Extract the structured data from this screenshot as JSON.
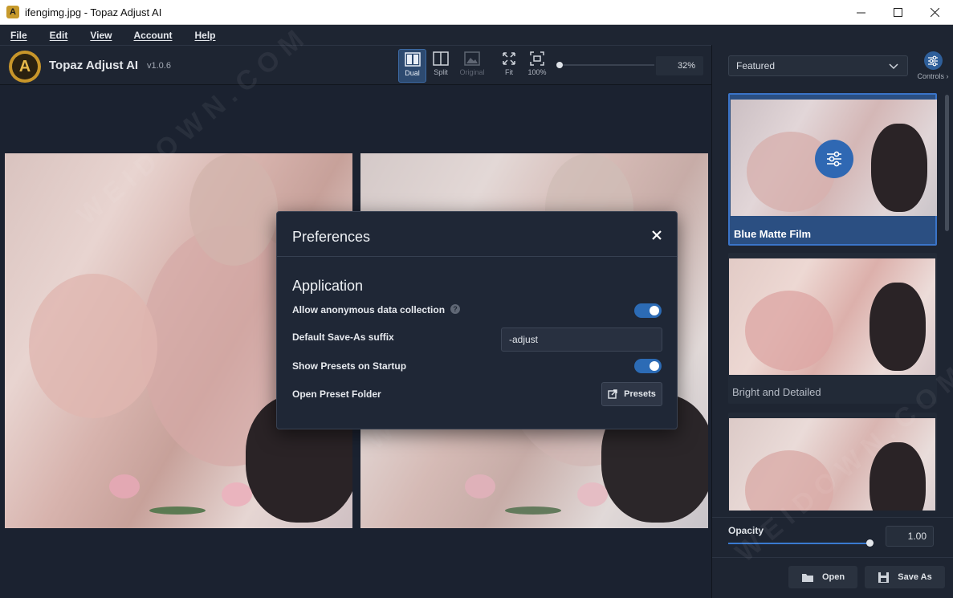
{
  "window": {
    "title": "ifengimg.jpg - Topaz Adjust AI",
    "app_glyph": "A",
    "minimize_icon": "minimize-icon",
    "maximize_icon": "maximize-icon",
    "close_icon": "close-icon"
  },
  "menu": [
    "File",
    "Edit",
    "View",
    "Account",
    "Help"
  ],
  "app": {
    "name": "Topaz Adjust AI",
    "version": "v1.0.6",
    "logo_letter": "A",
    "accent": "#c8962a"
  },
  "toolbar": {
    "view_modes": [
      {
        "label": "Dual",
        "icon": "dual-view-icon",
        "active": true
      },
      {
        "label": "Split",
        "icon": "split-view-icon",
        "active": false
      },
      {
        "label": "Original",
        "icon": "original-view-icon",
        "active": false,
        "disabled": true
      }
    ],
    "fit_label": "Fit",
    "actual_size_label": "100%",
    "zoom_value": "32%",
    "zoom_fraction": 0.0
  },
  "sidebar": {
    "filter_selected": "Featured",
    "controls_label": "Controls",
    "presets": [
      {
        "name": "Blue Matte Film",
        "selected": true
      },
      {
        "name": "Bright and Detailed",
        "selected": false
      },
      {
        "name": "",
        "selected": false
      }
    ],
    "opacity_label": "Opacity",
    "opacity_value": "1.00",
    "opacity_fraction": 1.0,
    "open_label": "Open",
    "save_as_label": "Save As"
  },
  "dialog": {
    "title": "Preferences",
    "section": "Application",
    "rows": {
      "anon_label": "Allow anonymous data collection",
      "anon_on": true,
      "suffix_label": "Default Save-As suffix",
      "suffix_value": "-adjust",
      "startup_label": "Show Presets on Startup",
      "startup_on": true,
      "folder_label": "Open Preset Folder",
      "presets_button": "Presets"
    }
  },
  "colors": {
    "accent_blue": "#2c6bb5",
    "selected_preset": "#2b4f82",
    "background": "#1b2230"
  }
}
